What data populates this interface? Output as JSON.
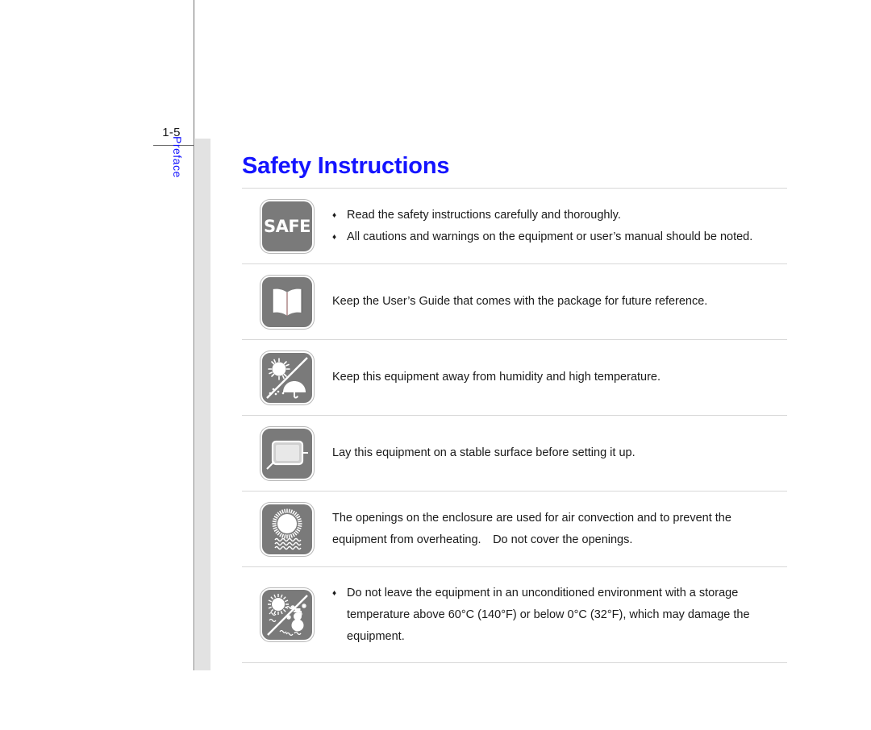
{
  "page": {
    "number": "1-5",
    "chapter_tab_label": "Preface",
    "title": "Safety Instructions",
    "title_color": "#1414ff",
    "tab_color": "#e2e2e2",
    "icon_background": "#7a7a7a"
  },
  "safety_rows": [
    {
      "icon_name": "safe-badge-icon",
      "icon_text": "SAFE",
      "lines": [
        {
          "bullet": true,
          "bullet_glyph": "♦",
          "text": "Read the safety instructions carefully and thoroughly."
        },
        {
          "bullet": true,
          "bullet_glyph": "♦",
          "text": "All cautions and warnings on the equipment or user’s manual should be noted."
        }
      ]
    },
    {
      "icon_name": "open-book-icon",
      "icon_text": "",
      "lines": [
        {
          "bullet": false,
          "bullet_glyph": "",
          "text": "Keep the User’s Guide that comes with the package for future reference."
        }
      ]
    },
    {
      "icon_name": "no-humidity-high-temperature-icon",
      "icon_text": "",
      "lines": [
        {
          "bullet": false,
          "bullet_glyph": "",
          "text": "Keep this equipment away from humidity and high temperature."
        }
      ]
    },
    {
      "icon_name": "stable-surface-icon",
      "icon_text": "",
      "lines": [
        {
          "bullet": false,
          "bullet_glyph": "",
          "text": "Lay this equipment on a stable surface before setting it up."
        }
      ]
    },
    {
      "icon_name": "air-convection-openings-icon",
      "icon_text": "",
      "lines": [
        {
          "bullet": false,
          "bullet_glyph": "",
          "text": "The openings on the enclosure are used for air convection and to prevent the"
        },
        {
          "bullet": false,
          "bullet_glyph": "",
          "text": "equipment from overheating. Do not cover the openings."
        }
      ]
    },
    {
      "icon_name": "temperature-extremes-icon",
      "icon_text": "",
      "lines": [
        {
          "bullet": true,
          "bullet_glyph": "♦",
          "text": "Do not leave the equipment in an unconditioned environment with a storage"
        },
        {
          "bullet": false,
          "bullet_glyph": "",
          "text": "temperature above 60°C (140°F) or below 0°C (32°F), which may damage the"
        },
        {
          "bullet": false,
          "bullet_glyph": "",
          "text": "equipment."
        }
      ]
    }
  ]
}
